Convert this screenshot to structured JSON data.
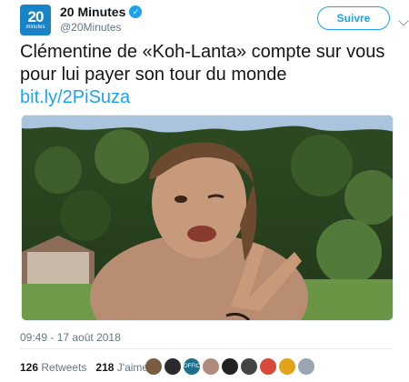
{
  "account": {
    "logo_number": "20",
    "logo_word": "minutes",
    "display_name": "20 Minutes",
    "handle": "@20Minutes",
    "verified_icon": "✓"
  },
  "actions": {
    "follow_label": "Suivre"
  },
  "tweet": {
    "text": "Clémentine de «Koh-Lanta» compte sur vous pour lui payer son tour du monde",
    "link": "bit.ly/2PiSuza",
    "timestamp": "09:49 - 17 août 2018"
  },
  "stats": {
    "retweets_count": "126",
    "retweets_label": "Retweets",
    "likes_count": "218",
    "likes_label": "J'aime"
  },
  "likers": [
    {
      "color": "#7a5c3e",
      "label": ""
    },
    {
      "color": "#2b2b2b",
      "label": ""
    },
    {
      "color": "#1f6f8b",
      "label": "OFFICIAL"
    },
    {
      "color": "#b08a7a",
      "label": ""
    },
    {
      "color": "#222222",
      "label": ""
    },
    {
      "color": "#444444",
      "label": ""
    },
    {
      "color": "#d94a3a",
      "label": ""
    },
    {
      "color": "#e2a21b",
      "label": ""
    },
    {
      "color": "#9aa5b1",
      "label": ""
    }
  ],
  "colors": {
    "brand": "#1a83c6",
    "link": "#1da1f2",
    "muted": "#657786"
  }
}
